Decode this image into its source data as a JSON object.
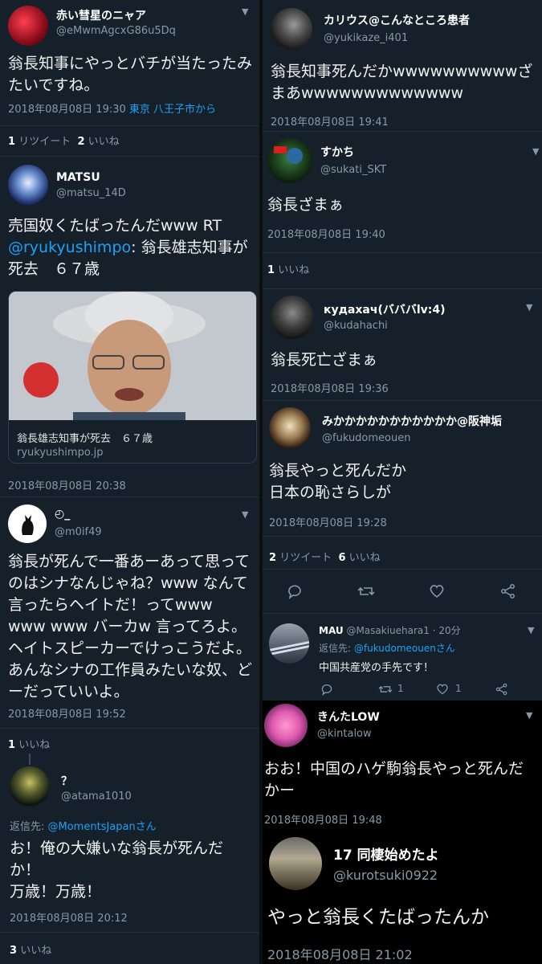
{
  "left": {
    "t1": {
      "name": "赤い彗星のニャア",
      "handle": "@eMwmAgcxG86u5Dq",
      "text": "翁長知事にやっとバチが当たったみたいですね。",
      "time": "2018年08月08日 19:30",
      "location": "東京 八王子市から",
      "rt_count": "1",
      "rt_label": "リツイート",
      "like_count": "2",
      "like_label": "いいね"
    },
    "t2": {
      "name": "MATSU",
      "handle": "@matsu_14D",
      "text_a": "売国奴くたばったんだwww RT",
      "mention": "@ryukyushimpo",
      "text_b": ": 翁長雄志知事が死去　６７歳",
      "card_title": "翁長雄志知事が死去　６７歳",
      "card_domain": "ryukyushimpo.jp",
      "time": "2018年08月08日 20:38"
    },
    "t3": {
      "name": "◴_",
      "handle": "@m0if49",
      "text": "翁長が死んで一番あーあって思ってのはシナなんじゃね？www なんて言ったらヘイトだ！ってwww www www バーカw 言ってろよ。ヘイトスピーカーでけっこうだよ。あんなシナの工作員みたいな奴、どーだっていいよ。",
      "time": "2018年08月08日 19:52",
      "like_count": "1",
      "like_label": "いいね"
    },
    "t4": {
      "name": "？",
      "handle": "@atama1010",
      "reply_prefix": "返信先: ",
      "reply_to": "@MomentsJapanさん",
      "text": "お！俺の大嫌いな翁長が死んだか！\n万歳！万歳！",
      "time": "2018年08月08日 20:12",
      "like_count": "3",
      "like_label": "いいね"
    }
  },
  "right": {
    "t1": {
      "name": "カリウス@こんなところ患者",
      "handle": "@yukikaze_i401",
      "text": "翁長知事死んだかwwwwwwwwwwざまあwwwwwwwwwwwww",
      "time": "2018年08月08日 19:41"
    },
    "t2": {
      "name": "すかち",
      "handle": "@sukati_SKT",
      "text": "翁長ざまぁ",
      "time": "2018年08月08日 19:40",
      "like_count": "1",
      "like_label": "いいね"
    },
    "t3": {
      "name": "кудахач(バババlv:4)",
      "handle": "@kudahachi",
      "text": "翁長死亡ざまぁ",
      "time": "2018年08月08日 19:36"
    },
    "t4": {
      "name": "みかかかかかかかかかかか@阪神垢",
      "handle": "@fukudomeouen",
      "text": "翁長やっと死んだか\n日本の恥さらしが",
      "time": "2018年08月08日 19:28",
      "rt_count": "2",
      "rt_label": "リツイート",
      "like_count": "6",
      "like_label": "いいね"
    },
    "t5": {
      "name": "MAU",
      "handle": "@Masakiuehara1",
      "age": "· 20分",
      "reply_prefix": "返信先: ",
      "reply_to": "@fukudomeouenさん",
      "text": "中国共産党の手先です！",
      "rt_count": "1",
      "like_count": "1"
    },
    "t6": {
      "name": "きんたLOW",
      "handle": "@kintalow",
      "text": "おお！中国のハゲ駒翁長やっと死んだかー",
      "time": "2018年08月08日 19:48"
    },
    "t7": {
      "name": "17 同棲始めたよ",
      "handle": "@kurotsuki0922",
      "text": "やっと翁長くたばったんか",
      "time": "2018年08月08日 21:02"
    }
  },
  "icons": {
    "chevron": "chevron-down-icon",
    "reply": "reply-icon",
    "retweet": "retweet-icon",
    "like": "heart-icon",
    "share": "share-icon"
  },
  "colors": {
    "bg": "#15202b",
    "accent": "#1da1f2",
    "muted": "#8899a6"
  }
}
